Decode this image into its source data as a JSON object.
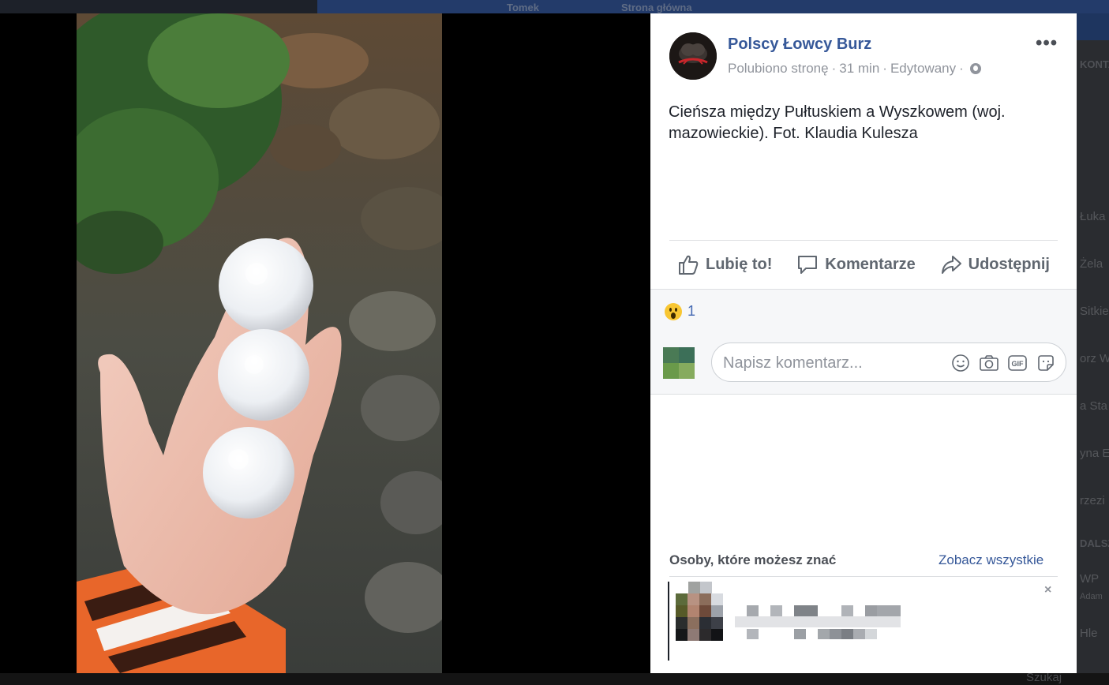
{
  "background": {
    "topbar_items": [
      "Tomek",
      "Strona główna"
    ],
    "sidebar_heading_1": "KONTAKTY",
    "sidebar_items": [
      "Łuka",
      "Żela",
      "Sitkie",
      "orz W",
      "a Sta",
      "yna E",
      "rzezi"
    ],
    "sidebar_heading_2": "DALSZE GRUPY",
    "sidebar_group": "WP",
    "sidebar_group_sub": "Adam",
    "sidebar_last": "Hle",
    "bottom_search": "Szukaj"
  },
  "post": {
    "page_name": "Polscy Łowcy Burz",
    "liked_status": "Polubiono stronę",
    "time": "31 min",
    "edited": "Edytowany",
    "separator": "·",
    "more_label": "•••",
    "text": "Cieńsza między Pułtuskiem a Wyszkowem (woj. mazowieckie). Fot. Klaudia Kulesza",
    "actions": {
      "like": "Lubię to!",
      "comment": "Komentarze",
      "share": "Udostępnij"
    },
    "reactions": {
      "type": "wow",
      "count": "1"
    },
    "comment_placeholder": "Napisz komentarz...",
    "comment_icons": [
      "emoji-icon",
      "camera-icon",
      "gif-icon",
      "sticker-icon"
    ],
    "gif_label": "GIF"
  },
  "pymk": {
    "title": "Osoby, które możesz znać",
    "see_all": "Zobacz wszystkie",
    "close": "×"
  },
  "colors": {
    "link_blue": "#365899",
    "muted": "#90949c",
    "action_gray": "#606770",
    "reaction_yellow": "#f8c632"
  }
}
